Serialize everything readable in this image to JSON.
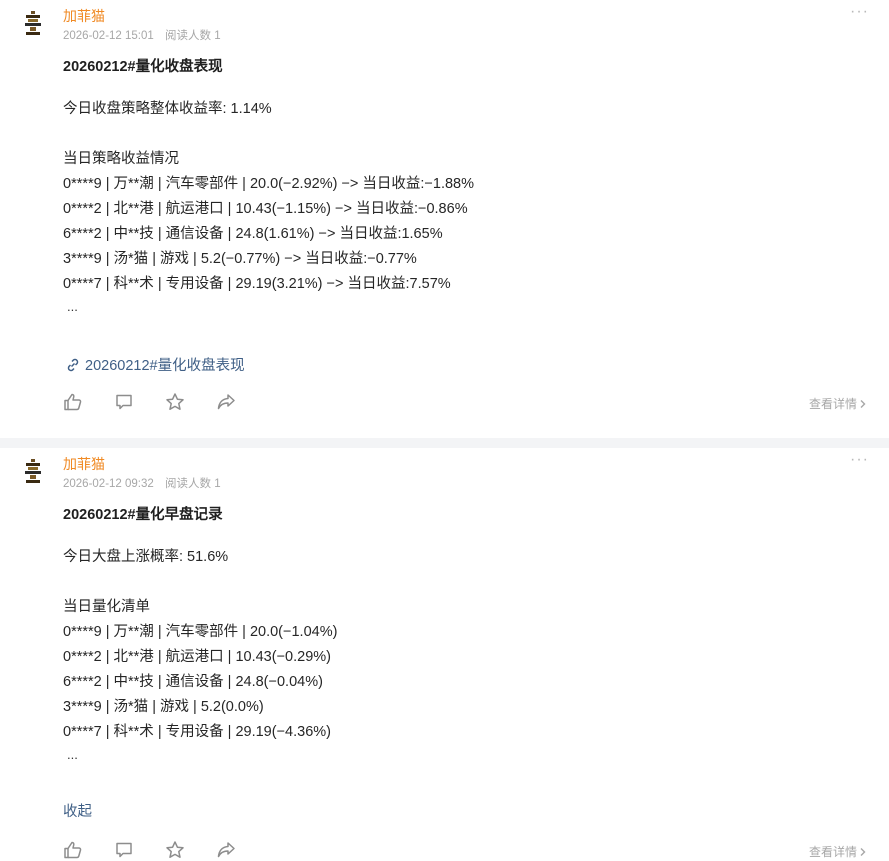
{
  "posts": [
    {
      "author": "加菲猫",
      "time": "2026-02-12 15:01",
      "reads": "阅读人数 1",
      "title": "20260212#量化收盘表现",
      "summary": "今日收盘策略整体收益率: 1.14%",
      "section": "当日策略收益情况",
      "rows": [
        "0****9 | 万**潮 | 汽车零部件 | 20.0(−2.92%) −> 当日收益:−1.88%",
        "0****2 | 北**港 | 航运港口 | 10.43(−1.15%) −> 当日收益:−0.86%",
        "6****2 | 中**技 | 通信设备 | 24.8(1.61%) −> 当日收益:1.65%",
        "3****9 | 汤*猫 | 游戏 | 5.2(−0.77%) −> 当日收益:−0.77%",
        "0****7 | 科**术 | 专用设备 | 29.19(3.21%) −> 当日收益:7.57%"
      ],
      "ellipsis": "...",
      "link": "20260212#量化收盘表现",
      "detail": "查看详情"
    },
    {
      "author": "加菲猫",
      "time": "2026-02-12 09:32",
      "reads": "阅读人数 1",
      "title": "20260212#量化早盘记录",
      "summary": "今日大盘上涨概率: 51.6%",
      "section": "当日量化清单",
      "rows": [
        "0****9 | 万**潮 | 汽车零部件 | 20.0(−1.04%)",
        "0****2 | 北**港 | 航运港口 | 10.43(−0.29%)",
        "6****2 | 中**技 | 通信设备 | 24.8(−0.04%)",
        "3****9 | 汤*猫 | 游戏 | 5.2(0.0%)",
        "0****7 | 科**术 | 专用设备 | 29.19(−4.36%)"
      ],
      "ellipsis": "...",
      "collapse": "收起",
      "detail": "查看详情"
    }
  ],
  "more_glyph": "···",
  "colors": {
    "author": "#f08a24",
    "link": "#3f5f86",
    "muted": "#a7a7a7"
  },
  "icons": [
    "avatar-icon",
    "like-icon",
    "comment-icon",
    "star-icon",
    "share-icon",
    "link-icon",
    "chevron-right-icon"
  ]
}
